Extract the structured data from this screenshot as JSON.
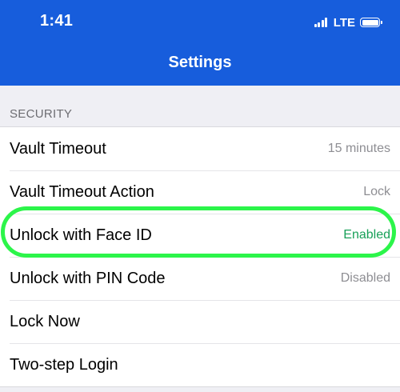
{
  "status_bar": {
    "time": "1:41",
    "network": "LTE",
    "signal_icon": "signal-bars-icon",
    "battery_icon": "battery-full-icon"
  },
  "header": {
    "title": "Settings",
    "background_color": "#175ddc"
  },
  "section": {
    "title": "SECURITY"
  },
  "rows": [
    {
      "label": "Vault Timeout",
      "value": "15 minutes"
    },
    {
      "label": "Vault Timeout Action",
      "value": "Lock"
    },
    {
      "label": "Unlock with Face ID",
      "value": "Enabled",
      "highlighted": true
    },
    {
      "label": "Unlock with PIN Code",
      "value": "Disabled"
    },
    {
      "label": "Lock Now",
      "value": ""
    },
    {
      "label": "Two-step Login",
      "value": ""
    }
  ],
  "colors": {
    "enabled_value": "#18a058",
    "highlight_outline": "#2cf54a"
  }
}
